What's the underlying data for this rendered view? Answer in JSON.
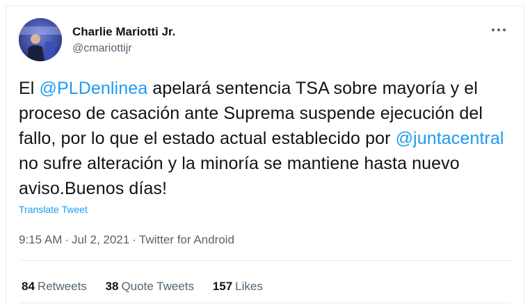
{
  "author": {
    "name": "Charlie Mariotti Jr.",
    "handle": "@cmariottijr"
  },
  "tweet": {
    "segments": [
      {
        "type": "text",
        "value": "El "
      },
      {
        "type": "mention",
        "value": "@PLDenlinea"
      },
      {
        "type": "text",
        "value": " apelará sentencia TSA sobre mayoría y el proceso de casación ante Suprema suspende ejecución del fallo, por lo que el estado actual establecido por "
      },
      {
        "type": "mention",
        "value": "@juntacentral"
      },
      {
        "type": "text",
        "value": " no sufre alteración y la minoría se mantiene hasta nuevo aviso.Buenos días!"
      }
    ],
    "translate_label": "Translate Tweet"
  },
  "meta": {
    "time": "9:15 AM",
    "separator": "·",
    "date": "Jul 2, 2021",
    "source": "Twitter for Android"
  },
  "stats": {
    "retweets_count": "84",
    "retweets_label": "Retweets",
    "quotes_count": "38",
    "quotes_label": "Quote Tweets",
    "likes_count": "157",
    "likes_label": "Likes"
  },
  "icons": {
    "more": "more-options-icon"
  },
  "colors": {
    "link": "#1d9bf0",
    "secondary_text": "#536471",
    "primary_text": "#0f1419"
  }
}
